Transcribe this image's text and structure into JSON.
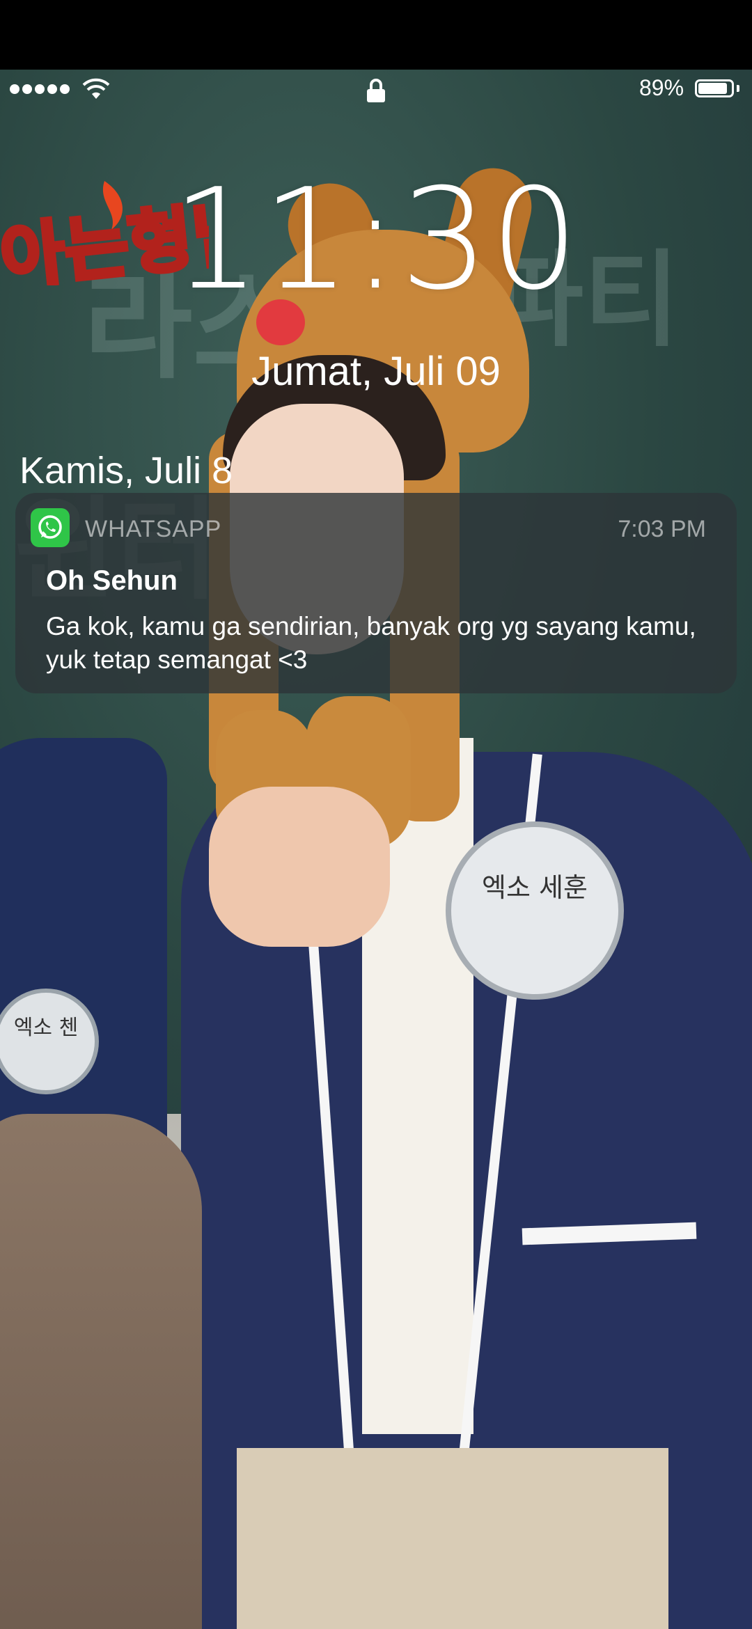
{
  "status_bar": {
    "signal_bars": 5,
    "battery_text": "89%",
    "battery_level": 0.89,
    "icons": [
      "signal-dots-icon",
      "wifi-icon",
      "lock-icon",
      "battery-icon"
    ]
  },
  "lock_screen": {
    "time": "11:30",
    "date": "Jumat, Juli 09"
  },
  "notifications": {
    "section_label": "Kamis, Juli 8",
    "items": [
      {
        "app": "WHATSAPP",
        "app_icon": "whatsapp-icon",
        "time": "7:03 PM",
        "sender": "Oh Sehun",
        "message": "Ga kok, kamu ga sendirian, banyak org yg sayang kamu, yuk tetap semangat <3"
      }
    ]
  },
  "wallpaper": {
    "logo_text": "아는형님",
    "badge_left_text": "엑소 첸",
    "badge_right_text": "엑소 세훈"
  },
  "colors": {
    "whatsapp_green": "#2fc548",
    "notification_bg": "#2d3438"
  }
}
